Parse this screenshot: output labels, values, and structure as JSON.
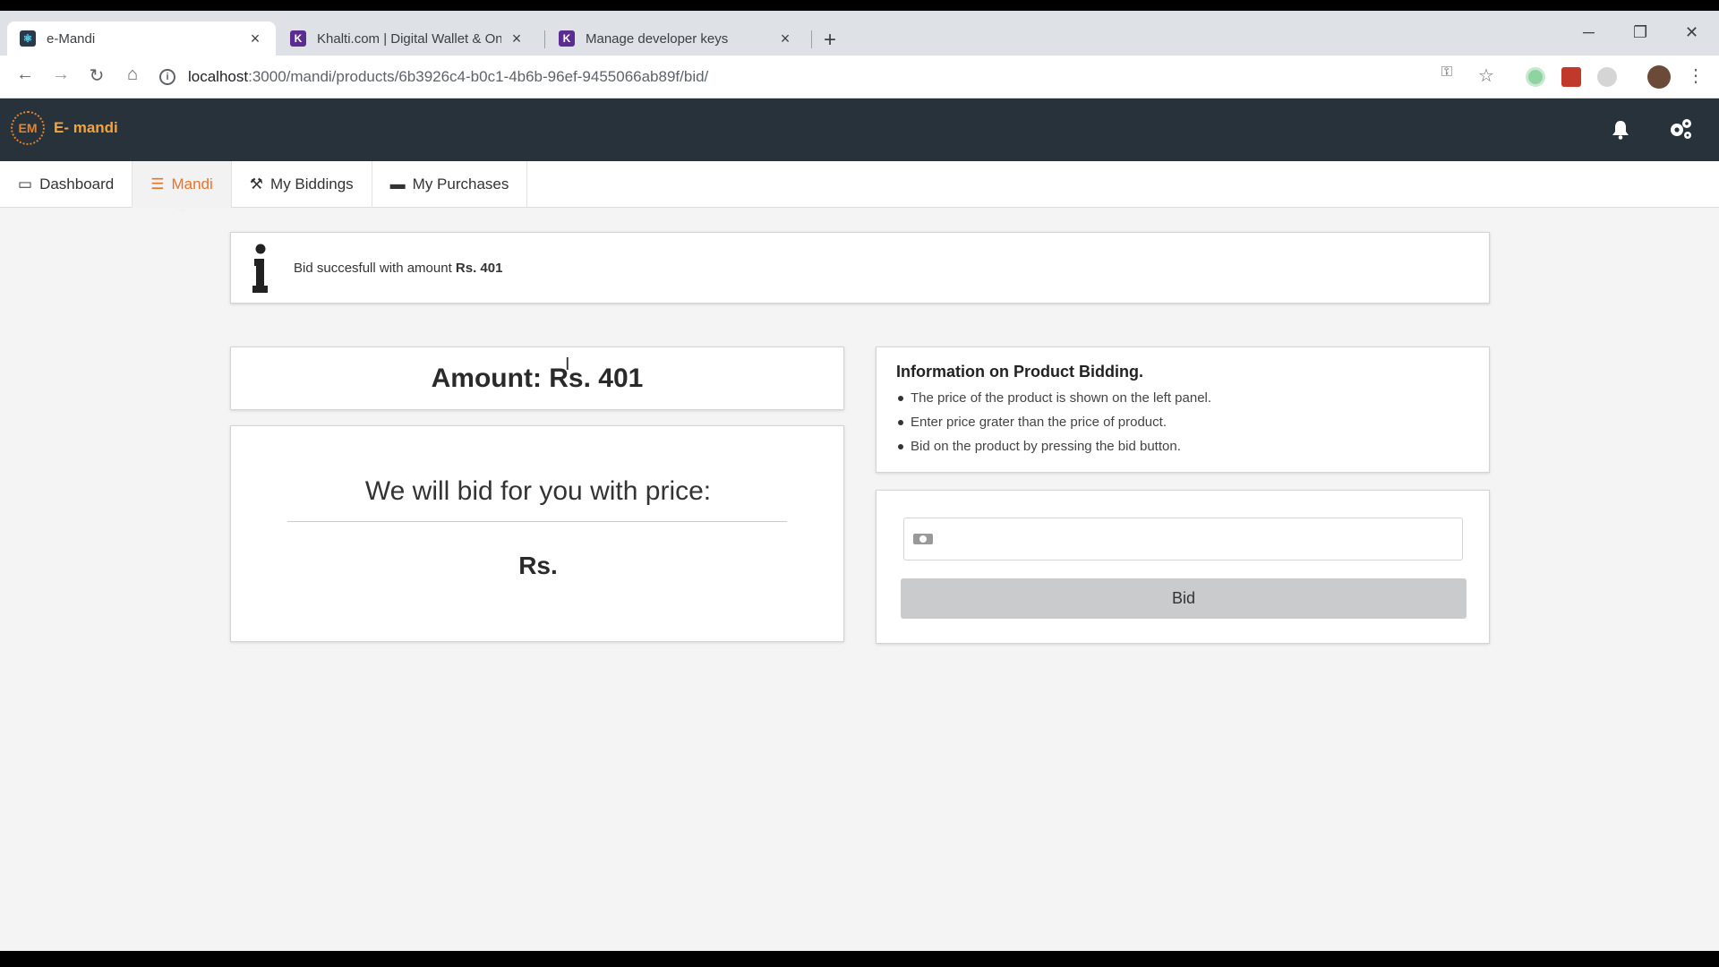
{
  "browser": {
    "tabs": [
      {
        "title": "e-Mandi",
        "favicon_color": "#2a3a4a"
      },
      {
        "title": "Khalti.com | Digital Wallet & Onli",
        "favicon_color": "#5c2d91"
      },
      {
        "title": "Manage developer keys",
        "favicon_color": "#5c2d91"
      }
    ],
    "url_host": "localhost",
    "url_path": ":3000/mandi/products/6b3926c4-b0c1-4b6b-96ef-9455066ab89f/bid/"
  },
  "app": {
    "logo_badge": "EM",
    "logo_text": "E- mandi",
    "accent": "#e8732a",
    "header_bg": "#27323a"
  },
  "menu": {
    "items": [
      {
        "label": "Dashboard",
        "icon": "laptop-icon",
        "glyph": "💻"
      },
      {
        "label": "Mandi",
        "icon": "list-icon",
        "glyph": "☰"
      },
      {
        "label": "My Biddings",
        "icon": "gavel-icon",
        "glyph": "🔨"
      },
      {
        "label": "My Purchases",
        "icon": "money-icon",
        "glyph": "💵"
      }
    ],
    "active": "Mandi"
  },
  "alert": {
    "prefix": "Bid succesfull with amount ",
    "amount": "Rs. 401"
  },
  "amount_card": {
    "text": "Amount: Rs. 401"
  },
  "price_card": {
    "title": "We will bid for you with price:",
    "value": "Rs."
  },
  "info": {
    "title": "Information on Product Bidding.",
    "items": [
      "The price of the product is shown on the left panel.",
      "Enter price grater than the price of product.",
      "Bid on the product by pressing the bid button."
    ]
  },
  "bid_form": {
    "input_value": "",
    "button_label": "Bid"
  }
}
